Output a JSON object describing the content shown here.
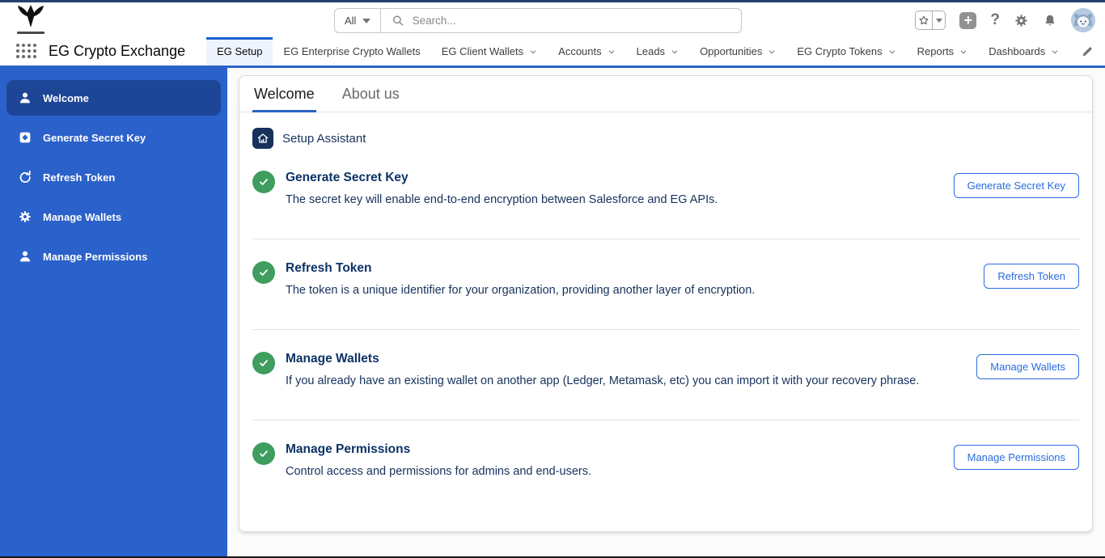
{
  "header": {
    "search_scope": "All",
    "search_placeholder": "Search..."
  },
  "nav": {
    "app_name": "EG Crypto Exchange",
    "tabs": [
      {
        "label": "EG Setup"
      },
      {
        "label": "EG Enterprise Crypto Wallets"
      },
      {
        "label": "EG Client Wallets"
      },
      {
        "label": "Accounts"
      },
      {
        "label": "Leads"
      },
      {
        "label": "Opportunities"
      },
      {
        "label": "EG Crypto Tokens"
      },
      {
        "label": "Reports"
      },
      {
        "label": "Dashboards"
      }
    ]
  },
  "sidebar": {
    "items": [
      {
        "label": "Welcome"
      },
      {
        "label": "Generate Secret Key"
      },
      {
        "label": "Refresh Token"
      },
      {
        "label": "Manage Wallets"
      },
      {
        "label": "Manage Permissions"
      }
    ]
  },
  "main": {
    "tabs": [
      {
        "label": "Welcome"
      },
      {
        "label": "About us"
      }
    ],
    "assistant_label": "Setup Assistant",
    "sections": [
      {
        "title": "Generate Secret Key",
        "description": "The secret key will enable end-to-end encryption between Salesforce and EG APIs.",
        "button": "Generate Secret Key"
      },
      {
        "title": "Refresh Token",
        "description": "The token is a unique identifier for your organization, providing another layer of encryption.",
        "button": "Refresh Token"
      },
      {
        "title": "Manage Wallets",
        "description": "If you already have an existing wallet on another app (Ledger, Metamask, etc) you can import it with your recovery phrase.",
        "button": "Manage Wallets"
      },
      {
        "title": "Manage Permissions",
        "description": "Control access and permissions for admins and end-users.",
        "button": "Manage Permissions"
      }
    ]
  },
  "colors": {
    "sidebar_blue": "#2b61ca",
    "sidebar_active_blue": "#1e4696",
    "accent_blue": "#2b6ce0",
    "nav_underline_blue": "#2b63c8",
    "success_green": "#3f9d5f",
    "navy_text": "#16325c"
  }
}
